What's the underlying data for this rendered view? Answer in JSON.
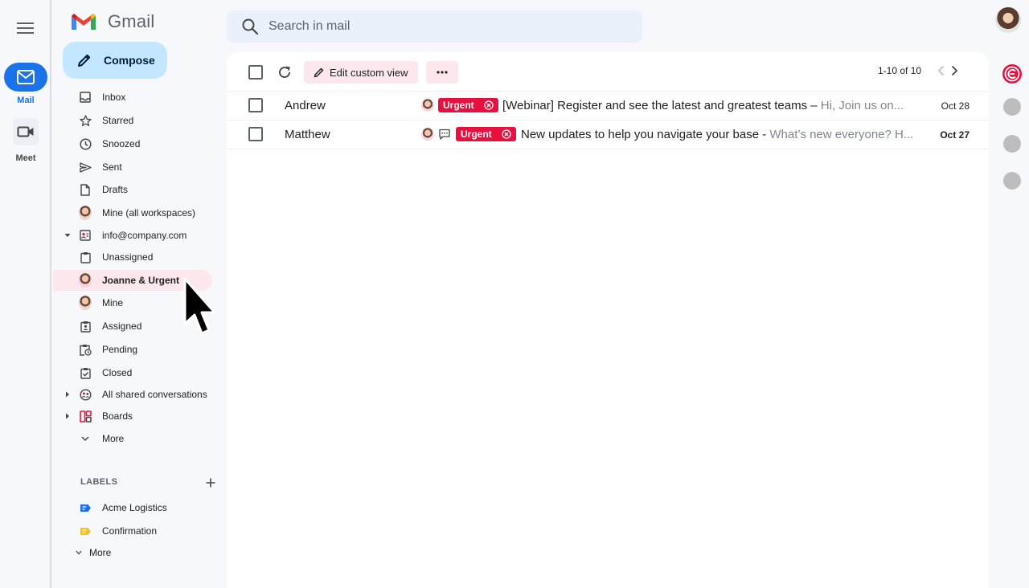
{
  "app": {
    "name": "Gmail"
  },
  "rail": {
    "mail_label": "Mail",
    "meet_label": "Meet"
  },
  "compose": {
    "label": "Compose"
  },
  "search": {
    "placeholder": "Search in mail"
  },
  "nav": {
    "items": [
      {
        "label": "Inbox"
      },
      {
        "label": "Starred"
      },
      {
        "label": "Snoozed"
      },
      {
        "label": "Sent"
      },
      {
        "label": "Drafts"
      },
      {
        "label": "Mine (all workspaces)"
      },
      {
        "label": "info@company.com"
      },
      {
        "label": "Unassigned"
      },
      {
        "label": "Joanne & Urgent"
      },
      {
        "label": "Mine"
      },
      {
        "label": "Assigned"
      },
      {
        "label": "Pending"
      },
      {
        "label": "Closed"
      },
      {
        "label": "All shared conversations"
      },
      {
        "label": "Boards"
      },
      {
        "label": "More"
      }
    ]
  },
  "labels": {
    "heading": "LABELS",
    "items": [
      {
        "label": "Acme Logistics",
        "color": "#1a73e8"
      },
      {
        "label": "Confirmation",
        "color": "#f6c026"
      }
    ],
    "more_label": "More"
  },
  "toolbar": {
    "edit_view_label": "Edit custom view",
    "pager_text": "1-10 of 10"
  },
  "emails": [
    {
      "sender": "Andrew",
      "tag": "Urgent",
      "subject": "[Webinar] Register and see the latest and greatest teams",
      "separator": " – ",
      "snippet": "Hi, Join us on...",
      "date": "Oct 28"
    },
    {
      "sender": "Matthew",
      "tag": "Urgent",
      "subject": "New updates to help you navigate your base",
      "separator": " - ",
      "snippet": "What’s new everyone? H...",
      "date": "Oct 27"
    }
  ],
  "colors": {
    "accent": "#1a73e8",
    "urgent": "#e8103e",
    "active_nav_bg": "#fce8ec",
    "compose_bg": "#c2e7ff"
  }
}
